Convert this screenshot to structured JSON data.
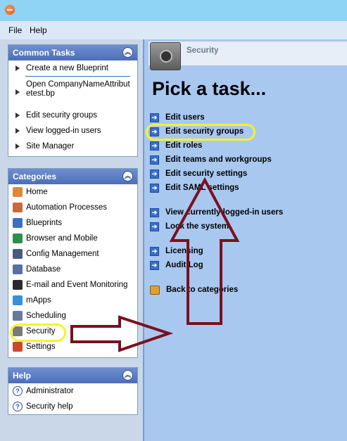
{
  "menu": {
    "file": "File",
    "help": "Help"
  },
  "common_tasks": {
    "title": "Common Tasks",
    "items": [
      {
        "label": "Create a new Blueprint"
      },
      {
        "label": "Open CompanyNameAttributetest.bp"
      },
      {
        "label": "Edit security groups"
      },
      {
        "label": "View logged-in users"
      },
      {
        "label": "Site Manager"
      }
    ]
  },
  "categories": {
    "title": "Categories",
    "items": [
      {
        "label": "Home",
        "icon": "home-icon",
        "color": "#d98a3a"
      },
      {
        "label": "Automation Processes",
        "icon": "people-icon",
        "color": "#c86a3a"
      },
      {
        "label": "Blueprints",
        "icon": "blueprint-icon",
        "color": "#3a6fc6"
      },
      {
        "label": "Browser and Mobile",
        "icon": "globe-icon",
        "color": "#2a8f4a"
      },
      {
        "label": "Config Management",
        "icon": "computer-icon",
        "color": "#4a5a7a"
      },
      {
        "label": "Database",
        "icon": "database-icon",
        "color": "#5a6fa0"
      },
      {
        "label": "E-mail and Event Monitoring",
        "icon": "monitor-icon",
        "color": "#2a2a2a"
      },
      {
        "label": "mApps",
        "icon": "mapps-icon",
        "color": "#3a8fd6"
      },
      {
        "label": "Scheduling",
        "icon": "calendar-icon",
        "color": "#6a7a9a"
      },
      {
        "label": "Security",
        "icon": "safe-icon",
        "color": "#7a7a7a"
      },
      {
        "label": "Settings",
        "icon": "settings-icon",
        "color": "#c84a2a"
      }
    ]
  },
  "help": {
    "title": "Help",
    "items": [
      {
        "label": "Administrator"
      },
      {
        "label": "Security help"
      }
    ]
  },
  "main": {
    "section_title": "Security",
    "heading": "Pick a task...",
    "tasks": [
      {
        "label": "Edit users"
      },
      {
        "label": "Edit security groups"
      },
      {
        "label": "Edit roles"
      },
      {
        "label": "Edit teams and workgroups"
      },
      {
        "label": "Edit security settings"
      },
      {
        "label": "Edit SAML settings"
      },
      {
        "label": "View currently logged-in users"
      },
      {
        "label": "Lock the system"
      },
      {
        "label": "Licensing"
      },
      {
        "label": "Audit Log"
      }
    ],
    "back": {
      "label": "Back to categories"
    }
  },
  "colors": {
    "highlight": "#f7f22a",
    "annotation_arrow": "#7a1020",
    "panel_header": "#4b6fb8"
  }
}
